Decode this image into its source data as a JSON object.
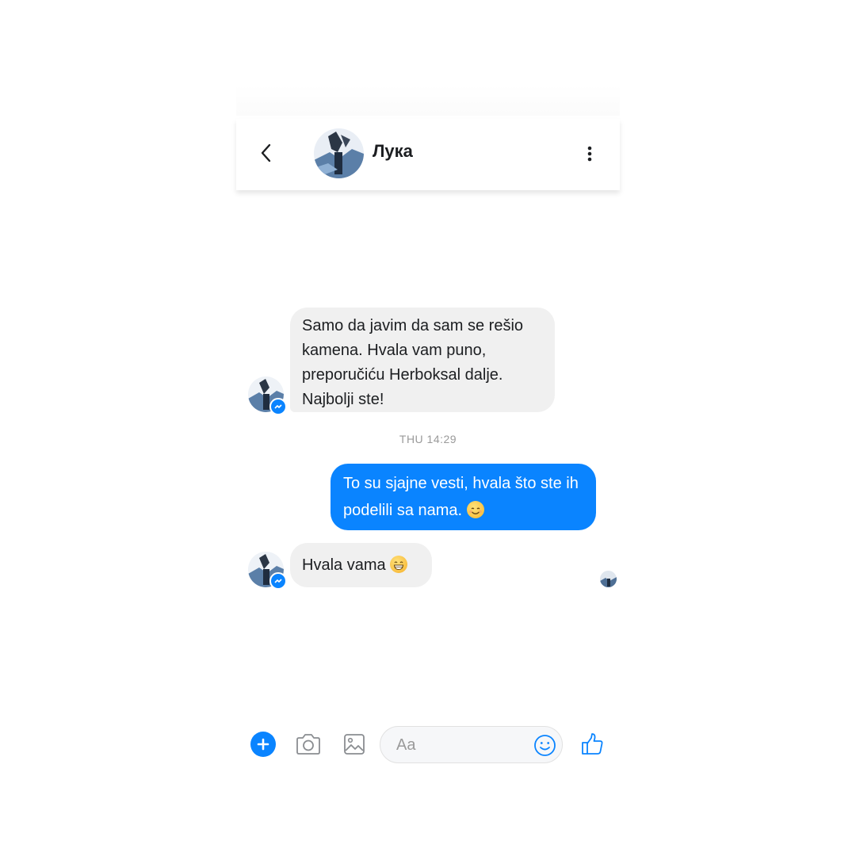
{
  "header": {
    "contact_name": "Лука"
  },
  "messages": [
    {
      "direction": "incoming",
      "text": "Samo da javim da sam se rešio kamena. Hvala vam puno, preporučiću Herboksal dalje. Najbolji ste!"
    },
    {
      "direction": "outgoing",
      "text": "To su sjajne vesti, hvala što ste ih podelili sa nama.",
      "emoji": "smiling-face-icon"
    },
    {
      "direction": "incoming",
      "text": "Hvala vama",
      "emoji": "grinning-face-icon"
    }
  ],
  "timestamp": "THU 14:29",
  "composer": {
    "placeholder": "Aa"
  },
  "colors": {
    "accent": "#0a84ff",
    "incoming_bubble": "#f0f0f0",
    "text": "#1c1e21",
    "timestamp": "#9a9a9a"
  }
}
